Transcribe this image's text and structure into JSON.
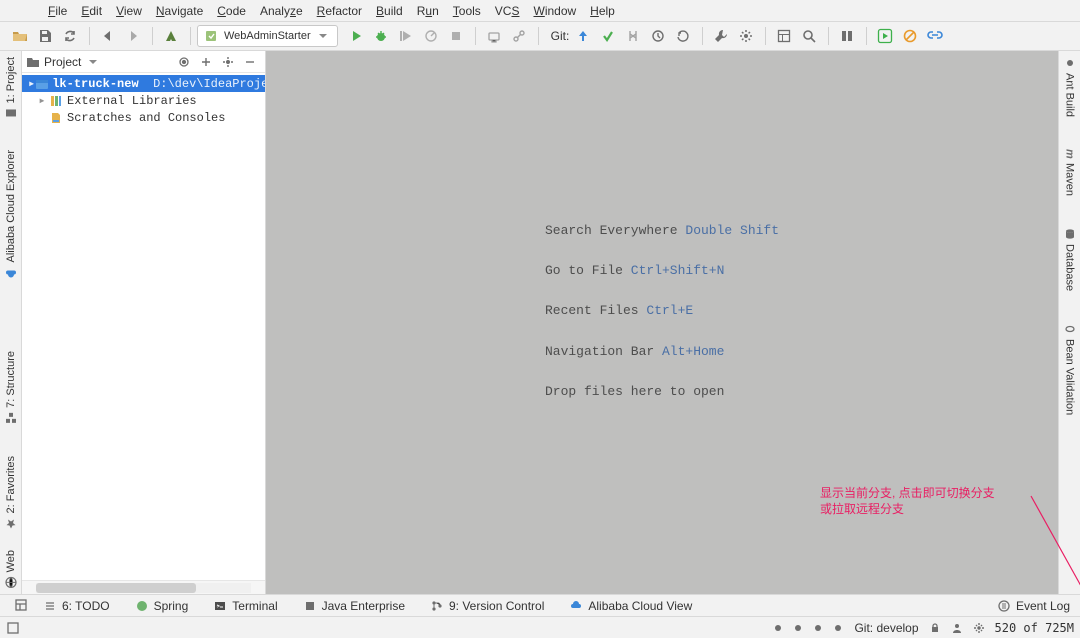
{
  "menu": [
    "File",
    "Edit",
    "View",
    "Navigate",
    "Code",
    "Analyze",
    "Refactor",
    "Build",
    "Run",
    "Tools",
    "VCS",
    "Window",
    "Help"
  ],
  "run_config": {
    "label": "WebAdminStarter"
  },
  "git_label": "Git:",
  "project": {
    "title": "Project",
    "items": [
      {
        "name": "lk-truck-new",
        "path": "D:\\dev\\IdeaProjects\\l",
        "selected": true,
        "kind": "module"
      },
      {
        "name": "External Libraries",
        "path": "",
        "selected": false,
        "kind": "libs"
      },
      {
        "name": "Scratches and Consoles",
        "path": "",
        "selected": false,
        "kind": "scratch"
      }
    ]
  },
  "left_vtabs": [
    {
      "label": "1: Project"
    },
    {
      "label": "Alibaba Cloud Explorer"
    },
    {
      "label": "7: Structure"
    },
    {
      "label": "2: Favorites"
    },
    {
      "label": "Web"
    }
  ],
  "right_vtabs": [
    {
      "label": "Ant Build"
    },
    {
      "label": "Maven"
    },
    {
      "label": "Database"
    },
    {
      "label": "Bean Validation"
    }
  ],
  "tips": [
    {
      "text": "Search Everywhere",
      "key": "Double Shift"
    },
    {
      "text": "Go to File",
      "key": "Ctrl+Shift+N"
    },
    {
      "text": "Recent Files",
      "key": "Ctrl+E"
    },
    {
      "text": "Navigation Bar",
      "key": "Alt+Home"
    },
    {
      "text": "Drop files here to open",
      "key": ""
    }
  ],
  "bottom_tabs": [
    {
      "label": "6: TODO"
    },
    {
      "label": "Spring"
    },
    {
      "label": "Terminal"
    },
    {
      "label": "Java Enterprise"
    },
    {
      "label": "9: Version Control"
    },
    {
      "label": "Alibaba Cloud View"
    }
  ],
  "event_log": "Event Log",
  "status": {
    "git": "Git: develop",
    "memory": "520 of 725M"
  },
  "annotation": {
    "line1": "显示当前分支, 点击即可切换分支",
    "line2": "或拉取远程分支"
  }
}
